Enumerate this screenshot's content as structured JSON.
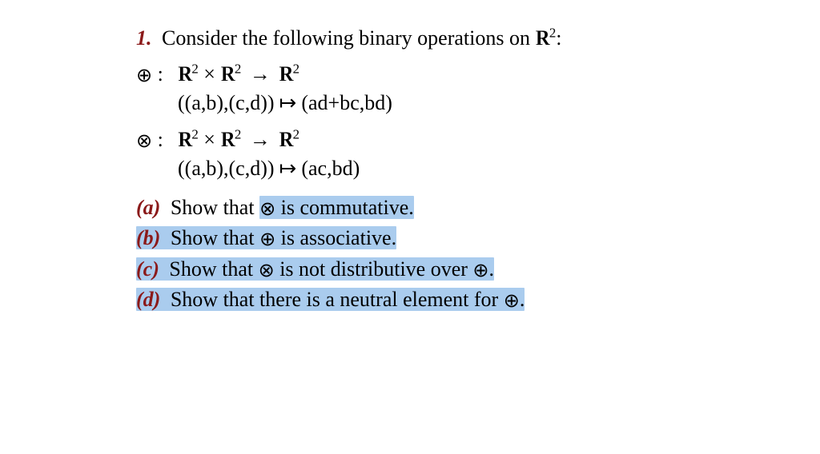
{
  "problem": {
    "number": "1.",
    "intro_prefix": "Consider the following binary operations on ",
    "intro_set": "ℝ²",
    "intro_suffix": ":"
  },
  "operations": {
    "oplus": {
      "symbol": "⊕",
      "domain": "ℝ² × ℝ² → ℝ²",
      "map_from": "((a,b),(c,d))",
      "map_to": "(ad+bc,bd)"
    },
    "otimes": {
      "symbol": "⊗",
      "domain": "ℝ² × ℝ² → ℝ²",
      "map_from": "((a,b),(c,d))",
      "map_to": "(ac,bd)"
    }
  },
  "parts": {
    "a": {
      "label": "(a)",
      "before": "Show that ",
      "sym": "⊗",
      "after": " is commutative."
    },
    "b": {
      "label": "(b)",
      "before": "Show that ",
      "sym": "⊕",
      "after": " is associative."
    },
    "c": {
      "label": "(c)",
      "before": "Show that ",
      "sym": "⊗",
      "mid": " is not distributive over ",
      "sym2": "⊕",
      "after": "."
    },
    "d": {
      "label": "(d)",
      "before": "Show that there is a neutral element for ",
      "sym": "⊕",
      "after": "."
    }
  },
  "glyphs": {
    "arrow": "→",
    "mapsto": "↦",
    "times": "×",
    "colon": ":"
  }
}
